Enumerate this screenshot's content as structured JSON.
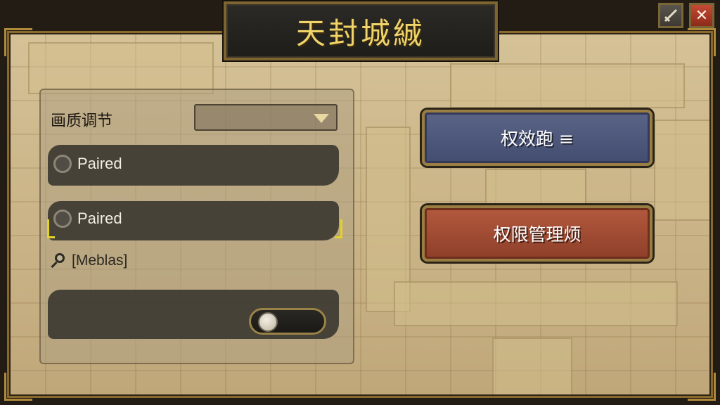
{
  "window": {
    "title": "天封城絾",
    "sword_icon": "sword-icon",
    "close_symbol": "✕"
  },
  "settings": {
    "quality_label": "画质调节",
    "dropdown_value": "",
    "radio_options": [
      {
        "label": "Paired",
        "selected": false
      },
      {
        "label": "Paired",
        "selected": false
      }
    ],
    "search_label": "[Meblas]",
    "toggle_on": false
  },
  "actions": {
    "primary_label": "权效跑 ≡",
    "secondary_label": "权限管理烦"
  },
  "colors": {
    "title": "#efd46a",
    "primary_button": "#4f5a7e",
    "secondary_button": "#a24c33",
    "focus_bracket": "#e3d22a"
  }
}
